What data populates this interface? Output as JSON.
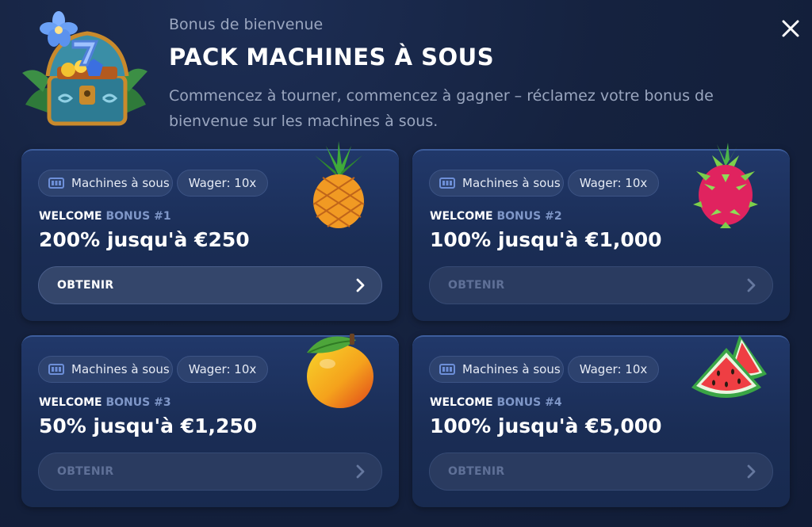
{
  "header": {
    "eyebrow": "Bonus de bienvenue",
    "title": "PACK MACHINES À SOUS",
    "description": "Commencez à tourner, commencez à gagner – réclamez votre bonus de bienvenue sur les machines à sous."
  },
  "icons": {
    "chest": "treasure-chest-icon",
    "close": "close-icon",
    "slot": "slot-machine-icon",
    "chevron": "chevron-right-icon"
  },
  "colors": {
    "background": "#15223f",
    "card": "#1c2f59",
    "chip": "#2d426e",
    "label_highlight": "#7f97c8",
    "muted_text": "#9aa6bf"
  },
  "cards": [
    {
      "category": "Machines à sous",
      "wager": "Wager: 10x",
      "label_prefix": "WELCOME ",
      "label_highlight": "BONUS #1",
      "amount": "200% jusqu'à €250",
      "button": "OBTENIR",
      "fruit": "pineapple-icon",
      "active": true
    },
    {
      "category": "Machines à sous",
      "wager": "Wager: 10x",
      "label_prefix": "WELCOME ",
      "label_highlight": "BONUS #2",
      "amount": "100% jusqu'à €1,000",
      "button": "OBTENIR",
      "fruit": "dragon-fruit-icon",
      "active": false
    },
    {
      "category": "Machines à sous",
      "wager": "Wager: 10x",
      "label_prefix": "WELCOME ",
      "label_highlight": "BONUS #3",
      "amount": "50% jusqu'à €1,250",
      "button": "OBTENIR",
      "fruit": "mango-icon",
      "active": false
    },
    {
      "category": "Machines à sous",
      "wager": "Wager: 10x",
      "label_prefix": "WELCOME ",
      "label_highlight": "BONUS #4",
      "amount": "100% jusqu'à €5,000",
      "button": "OBTENIR",
      "fruit": "watermelon-icon",
      "active": false
    }
  ]
}
